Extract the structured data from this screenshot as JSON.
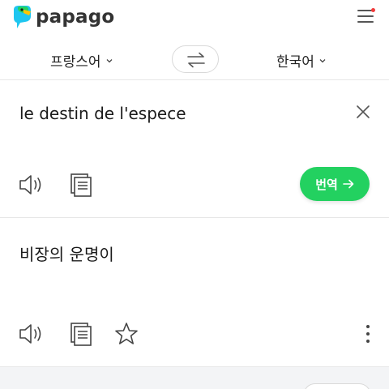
{
  "app": {
    "name": "papago"
  },
  "languages": {
    "source": "프랑스어",
    "target": "한국어"
  },
  "source_panel": {
    "text": "le destin de l'espece"
  },
  "translate_button": {
    "label": "번역"
  },
  "result_panel": {
    "text": "비장의 운명이"
  },
  "icons": {
    "logo": "papago-parrot-logo",
    "menu": "hamburger-menu-icon",
    "swap": "swap-languages-icon",
    "close": "close-icon",
    "speaker": "speaker-icon",
    "copy": "copy-icon",
    "star": "star-icon",
    "more": "more-vertical-icon",
    "arrow": "arrow-right-icon"
  },
  "colors": {
    "accent_green": "#23d160",
    "notification_dot": "#f03a3a",
    "divider": "#e6e6e6"
  }
}
